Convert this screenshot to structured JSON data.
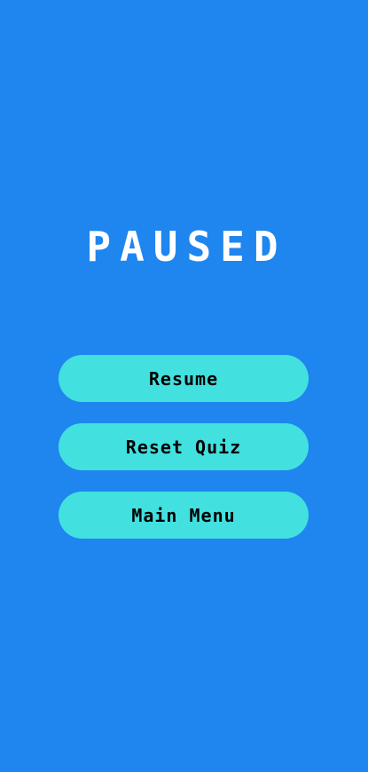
{
  "pause_screen": {
    "title": "PAUSED",
    "buttons": {
      "resume": "Resume",
      "reset_quiz": "Reset Quiz",
      "main_menu": "Main Menu"
    }
  },
  "colors": {
    "background": "#1e86ee",
    "button": "#43e0e0",
    "title_text": "#ffffff",
    "button_text": "#000000"
  }
}
